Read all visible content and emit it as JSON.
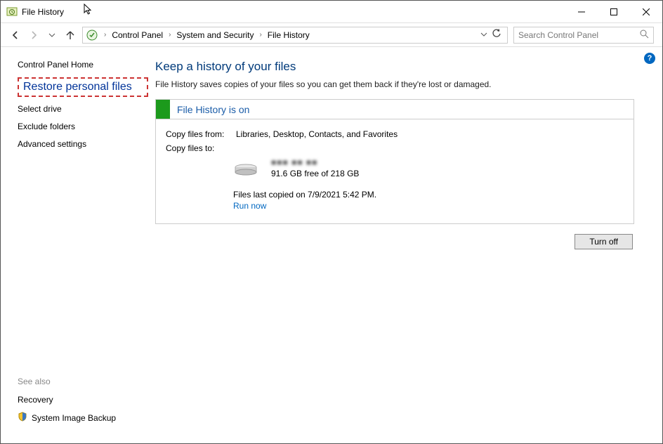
{
  "window": {
    "title": "File History"
  },
  "breadcrumb": {
    "root": "Control Panel",
    "mid": "System and Security",
    "leaf": "File History"
  },
  "search": {
    "placeholder": "Search Control Panel"
  },
  "sidebar": {
    "home": "Control Panel Home",
    "restore": "Restore personal files",
    "select_drive": "Select drive",
    "exclude": "Exclude folders",
    "advanced": "Advanced settings"
  },
  "see_also": {
    "header": "See also",
    "recovery": "Recovery",
    "sib": "System Image Backup"
  },
  "main": {
    "heading": "Keep a history of your files",
    "sub": "File History saves copies of your files so you can get them back if they're lost or damaged.",
    "panel_title": "File History is on",
    "copy_from_label": "Copy files from:",
    "copy_from_value": "Libraries, Desktop, Contacts, and Favorites",
    "copy_to_label": "Copy files to:",
    "drive_name": "■■■ ■■ ■■",
    "drive_free": "91.6 GB free of 218 GB",
    "last_copied": "Files last copied on 7/9/2021 5:42 PM.",
    "run_now": "Run now",
    "turn_off": "Turn off"
  }
}
